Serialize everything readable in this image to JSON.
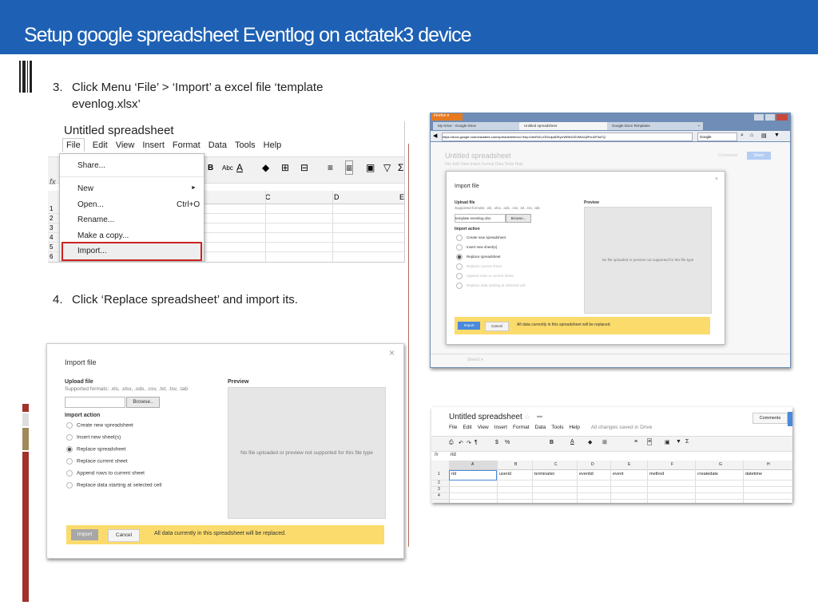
{
  "slide": {
    "title": "Setup google spreadsheet Eventlog on actatek3 device",
    "step3": {
      "num": "3.",
      "text_line1": "Click Menu ‘File’ > ‘Import’ a excel file ‘template",
      "text_line2": "evenlog.xlsx’"
    },
    "step4": {
      "num": "4.",
      "text": "Click ‘Replace spreadsheet’ and import its."
    }
  },
  "menu_shot": {
    "doc_title": "Untitled spreadsheet",
    "menubar": [
      "File",
      "Edit",
      "View",
      "Insert",
      "Format",
      "Data",
      "Tools",
      "Help"
    ],
    "fx": "fx",
    "columns": [
      "C",
      "D",
      "E"
    ],
    "rows": [
      "1",
      "2",
      "3",
      "4",
      "5",
      "6"
    ],
    "dropdown": {
      "share": "Share...",
      "new": "New",
      "new_arrow": "►",
      "open": "Open...",
      "open_shortcut": "Ctrl+O",
      "rename": "Rename...",
      "copy": "Make a copy...",
      "import": "Import..."
    }
  },
  "browser": {
    "firefox_label": "Firefox ▾",
    "tabs": [
      "My Drive - Google Drive",
      "Untitled spreadsheet",
      "Google Docs Templates"
    ],
    "new_tab": "+",
    "url": "https://docs.google.com/a/actatek.com/spreadsheet/ccc?key=0AvRxD-iODndpdDEyUWt5bGlZVM0cQtPvuDF3aTQ",
    "search": "Google",
    "doc_title": "Untitled spreadsheet",
    "menubar": "File  Edit  View  Insert  Format  Data  Tools  Help",
    "comments": "Comments",
    "share": "Share",
    "sheet_tab": "Sheet1 ▾"
  },
  "small_dialog": {
    "title": "Import file",
    "close": "×",
    "upload_heading": "Upload file",
    "formats": "Supported formats: .xls, .xlsx, .ods, .csv, .txt, .tsv, .tab",
    "file_value": "template eventlog.xlsx",
    "browse": "Browse...",
    "action_heading": "Import action",
    "options": [
      "Create new spreadsheet",
      "Insert new sheet(s)",
      "Replace spreadsheet",
      "Replace current sheet",
      "Append rows to current sheet",
      "Replace data starting at selected cell"
    ],
    "preview_heading": "Preview",
    "preview_text": "No file uploaded or preview not supported for this file type",
    "import_btn": "Import",
    "cancel_btn": "Cancel",
    "warning": "All data currently in this spreadsheet will be replaced."
  },
  "large_dialog": {
    "title": "Import file",
    "close": "×",
    "upload_heading": "Upload file",
    "formats": "Supported formats: .xls, .xlsx, .ods, .csv, .txt, .tsv, .tab",
    "browse": "Browse..",
    "action_heading": "Import action",
    "options": [
      "Create new spreadsheet",
      "Insert new sheet(s)",
      "Replace spreadsheet",
      "Replace current sheet",
      "Append rows to current sheet",
      "Replace data starting at selected cell"
    ],
    "preview_heading": "Preview",
    "preview_text": "No file uploaded or preview not supported for this file type",
    "import_btn": "Import",
    "cancel_btn": "Cancel",
    "warning": "All data currently in this spreadsheet will be replaced."
  },
  "result_sheet": {
    "doc_title": "Untitled spreadsheet",
    "star": "☆",
    "folder": "▬",
    "menubar": [
      "File",
      "Edit",
      "View",
      "Insert",
      "Format",
      "Data",
      "Tools",
      "Help"
    ],
    "saved": "All changes saved in Drive",
    "comments": "Comments",
    "fx": "fx",
    "formula": "rid",
    "columns": [
      "A",
      "B",
      "C",
      "D",
      "E",
      "F",
      "G",
      "H"
    ],
    "rows": [
      "1",
      "2",
      "3",
      "4"
    ],
    "headers": [
      "rid",
      "userid",
      "terminalsn",
      "eventid",
      "event",
      "method",
      "createdate",
      "datetime"
    ]
  }
}
